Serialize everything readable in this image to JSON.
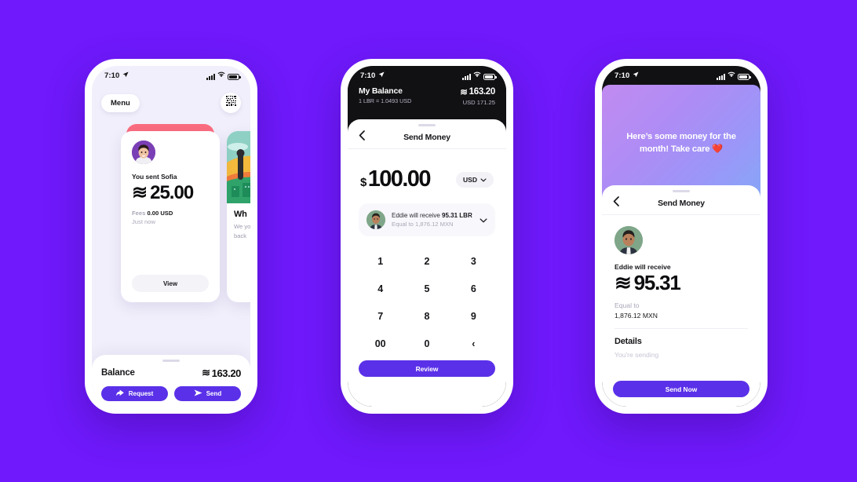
{
  "background_color": "#6F19FC",
  "accent_color": "#5A31E8",
  "phone1": {
    "status": {
      "time": "7:10",
      "location_icon": "location-arrow-icon",
      "signal_icon": "cellular-signal-icon",
      "wifi_icon": "wifi-icon",
      "battery_icon": "battery-icon"
    },
    "menu_label": "Menu",
    "qr_icon": "qr-code-icon",
    "card": {
      "title": "You sent Sofia",
      "libra_symbol": "≋",
      "amount": "25.00",
      "fees_label": "Fees",
      "fees_value": "0.00 USD",
      "timestamp": "Just now",
      "view_label": "View"
    },
    "side_card": {
      "heading": "Wh",
      "body": "We  your  cryp back"
    },
    "balance": {
      "label": "Balance",
      "libra_symbol": "≋",
      "value": "163.20"
    },
    "request_label": "Request",
    "request_icon": "reply-arrow-icon",
    "send_label": "Send",
    "send_icon": "paper-plane-icon"
  },
  "phone2": {
    "status": {
      "time": "7:10",
      "location_icon": "location-arrow-icon",
      "signal_icon": "cellular-signal-icon",
      "wifi_icon": "wifi-icon",
      "battery_icon": "battery-icon"
    },
    "header": {
      "title": "My Balance",
      "rate": "1 LBR = 1.0493 USD",
      "libra_symbol": "≋",
      "balance": "163.20",
      "usd": "USD 171.25"
    },
    "nav": {
      "back_icon": "chevron-left-icon",
      "title": "Send Money"
    },
    "amount": {
      "currency_symbol": "$",
      "value": "100.00"
    },
    "currency_pill": {
      "label": "USD",
      "icon": "chevron-down-icon"
    },
    "recipient": {
      "avatar": "recipient-avatar",
      "line1_prefix": "Eddie will receive ",
      "line1_amount": "95.31 LBR",
      "line2": "Equal to 1,876.12 MXN",
      "expand_icon": "chevron-down-icon"
    },
    "keys": [
      "1",
      "2",
      "3",
      "4",
      "5",
      "6",
      "7",
      "8",
      "9",
      "00",
      "0",
      "‹"
    ],
    "review_label": "Review"
  },
  "phone3": {
    "status": {
      "time": "7:10",
      "location_icon": "location-arrow-icon",
      "signal_icon": "cellular-signal-icon",
      "wifi_icon": "wifi-icon",
      "battery_icon": "battery-icon"
    },
    "hero_message": "Here’s some money for the month! Take care ❤️",
    "nav": {
      "back_icon": "chevron-left-icon",
      "title": "Send Money"
    },
    "receive_label": "Eddie will receive",
    "libra_symbol": "≋",
    "receive_amount": "95.31",
    "equal_label": "Equal to",
    "equal_value": "1,876.12 MXN",
    "details_label": "Details",
    "details_sub": "You're sending",
    "send_now_label": "Send Now"
  }
}
